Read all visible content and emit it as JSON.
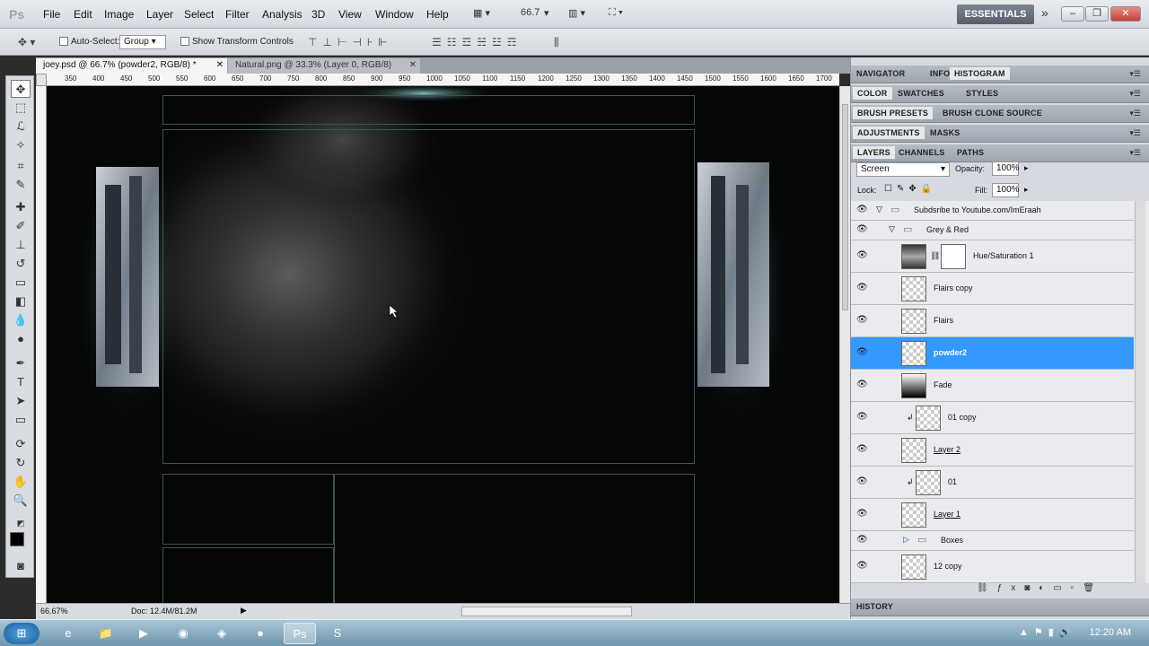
{
  "menubar": {
    "app_logo": "Ps",
    "items": [
      "File",
      "Edit",
      "Image",
      "Layer",
      "Select",
      "Filter",
      "Analysis",
      "3D",
      "View",
      "Window",
      "Help"
    ],
    "zoom_value": "66.7",
    "workspace": "ESSENTIALS"
  },
  "options": {
    "auto_select_label": "Auto-Select:",
    "auto_select_value": "Group",
    "show_transform_label": "Show Transform Controls"
  },
  "tabs": [
    {
      "label": "joey.psd @ 66.7% (powder2, RGB/8) *",
      "active": true
    },
    {
      "label": "Natural.png @ 33.3% (Layer 0, RGB/8)",
      "active": false
    }
  ],
  "ruler_ticks": [
    "350",
    "400",
    "450",
    "500",
    "550",
    "600",
    "650",
    "700",
    "750",
    "800",
    "850",
    "900",
    "950",
    "1000",
    "1050",
    "1100",
    "1150",
    "1200",
    "1250",
    "1300",
    "1350",
    "1400",
    "1450",
    "1500",
    "1550",
    "1600",
    "1650",
    "1700"
  ],
  "status": {
    "zoom": "66.67%",
    "doc": "Doc: 12.4M/81.2M"
  },
  "panels": {
    "group1": [
      "NAVIGATOR",
      "INFO",
      "HISTOGRAM"
    ],
    "group2": [
      "COLOR",
      "SWATCHES",
      "STYLES"
    ],
    "group3": [
      "BRUSH PRESETS",
      "BRUSH",
      "CLONE SOURCE"
    ],
    "group4": [
      "ADJUSTMENTS",
      "MASKS"
    ],
    "group5": [
      "LAYERS",
      "CHANNELS",
      "PATHS"
    ],
    "history": "HISTORY"
  },
  "layers_panel": {
    "blend_mode": "Screen",
    "opacity_label": "Opacity:",
    "opacity_value": "100%",
    "lock_label": "Lock:",
    "fill_label": "Fill:",
    "fill_value": "100%",
    "rows": [
      {
        "name": "Subdsribe to Youtube.com/ImEraah",
        "kind": "group"
      },
      {
        "name": "Grey & Red",
        "kind": "group"
      },
      {
        "name": "Hue/Saturation 1",
        "kind": "adjustment"
      },
      {
        "name": "Flairs copy",
        "kind": "layer"
      },
      {
        "name": "Flairs",
        "kind": "layer"
      },
      {
        "name": "powder2",
        "kind": "layer",
        "selected": true
      },
      {
        "name": "Fade",
        "kind": "layer"
      },
      {
        "name": "01 copy",
        "kind": "clipped"
      },
      {
        "name": "Layer 2",
        "kind": "layer"
      },
      {
        "name": "01",
        "kind": "clipped"
      },
      {
        "name": "Layer 1",
        "kind": "layer"
      },
      {
        "name": "Boxes",
        "kind": "group"
      },
      {
        "name": "12 copy",
        "kind": "layer"
      }
    ]
  },
  "taskbar": {
    "clock": "12:20 AM"
  }
}
